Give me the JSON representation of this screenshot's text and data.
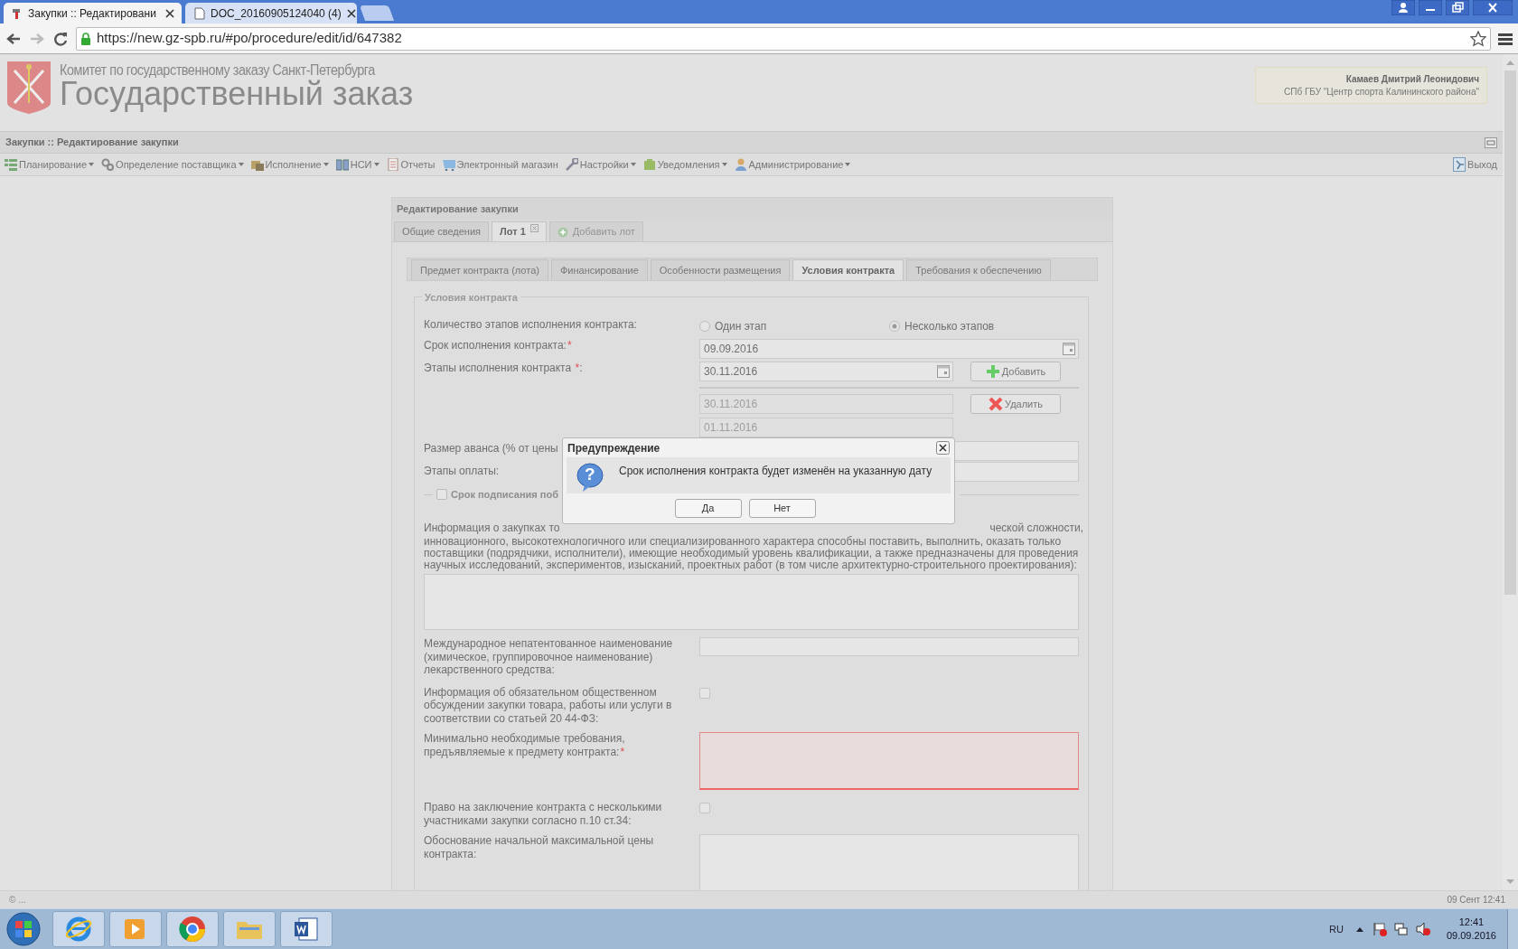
{
  "browser": {
    "tabs": [
      {
        "title": "Закупки :: Редактировани",
        "selected": true
      },
      {
        "title": "DOC_20160905124040 (4)",
        "selected": false
      }
    ],
    "url": "https://new.gz-spb.ru/#po/procedure/edit/id/647382"
  },
  "header": {
    "org": "Комитет по государственному заказу Санкт-Петербурга",
    "title": "Государственный заказ",
    "user_name": "Камаев Дмитрий Леонидович",
    "user_org": "СПб ГБУ \"Центр спорта Калининского района\""
  },
  "app_title": "Закупки :: Редактирование закупки",
  "menu": [
    {
      "label": "Планирование",
      "dropdown": true
    },
    {
      "label": "Определение поставщика",
      "dropdown": true
    },
    {
      "label": "Исполнение",
      "dropdown": true
    },
    {
      "label": "НСИ",
      "dropdown": true
    },
    {
      "label": "Отчеты",
      "dropdown": false
    },
    {
      "label": "Электронный магазин",
      "dropdown": false
    },
    {
      "label": "Настройки",
      "dropdown": true
    },
    {
      "label": "Уведомления",
      "dropdown": true
    },
    {
      "label": "Администрирование",
      "dropdown": true
    }
  ],
  "exit": "Выход",
  "panel_title": "Редактирование закупки",
  "lot_tabs": [
    {
      "kind": "tab",
      "label": "Общие сведения",
      "selected": false
    },
    {
      "kind": "closable",
      "label": "Лот 1",
      "selected": true
    },
    {
      "kind": "add",
      "label": "Добавить лот",
      "selected": false
    }
  ],
  "section_tabs": [
    {
      "label": "Предмет контракта (лота)",
      "selected": false
    },
    {
      "label": "Финансирование",
      "selected": false
    },
    {
      "label": "Особенности размещения",
      "selected": false
    },
    {
      "label": "Условия контракта",
      "selected": true
    },
    {
      "label": "Требования к обеспечению",
      "selected": false
    }
  ],
  "legend": "Условия контракта",
  "stage_count": {
    "label": "Количество этапов исполнения контракта:",
    "options": [
      {
        "label": "Один этап",
        "selected": false
      },
      {
        "label": "Несколько этапов",
        "selected": true
      }
    ]
  },
  "contract_term": {
    "label": "Срок исполнения контракта:",
    "required": true,
    "value": "09.09.2016"
  },
  "required_mark": "*",
  "stages": {
    "label": "Этапы исполнения контракта ",
    "label_suffix": ":",
    "required": true,
    "value": "30.11.2016",
    "add_button": "Добавить",
    "delete_button": "Удалить",
    "items": [
      "30.11.2016",
      "01.11.2016"
    ]
  },
  "advance_label": "Размер аванса (% от цены",
  "payment_label": "Этапы оплаты:",
  "signing": {
    "label": "Срок подписания поб",
    "checked": false
  },
  "info": {
    "line1_left": "Информация о закупках то",
    "line1_right": "ческой сложности,",
    "rest": "инновационного, высокотехнологичного или специализированного характера способны поставить, выполнить, оказать только поставщики (подрядчики, исполнители), имеющие необходимый уровень квалификации, а также предназначены для проведения научных исследований, экспериментов, изысканий, проектных работ (в том числе архитектурно-строительного проектирования):"
  },
  "rows": [
    {
      "kind": "text",
      "label": "Международное непатентованное наименование (химическое, группировочное наименование) лекарственного средства:",
      "required": false,
      "invalid": false
    },
    {
      "kind": "checkbox",
      "label": "Информация об обязательном общественном обсуждении закупки товара, работы или услуги в соответствии со статьей 20 44-ФЗ:",
      "checked": false
    },
    {
      "kind": "textarea",
      "label": "Минимально необходимые требования, предъявляемые к предмету контракта:",
      "required": true,
      "invalid": true
    },
    {
      "kind": "checkbox",
      "label": "Право на заключение контракта с несколькими участниками закупки согласно п.10 ст.34:",
      "checked": false
    },
    {
      "kind": "textarea",
      "label": "Обоснование начальной максимальной цены контракта:",
      "required": false,
      "invalid": false
    }
  ],
  "dialog": {
    "title": "Предупреждение",
    "icon": "?",
    "message": "Срок исполнения контракта будет изменён на указанную дату",
    "buttons": [
      "Да",
      "Нет"
    ]
  },
  "status_bar": {
    "left": "© ...",
    "right": "09 Сент 12:41"
  },
  "taskbar": {
    "lang": "RU",
    "time": "12:41",
    "date": "09.09.2016"
  }
}
